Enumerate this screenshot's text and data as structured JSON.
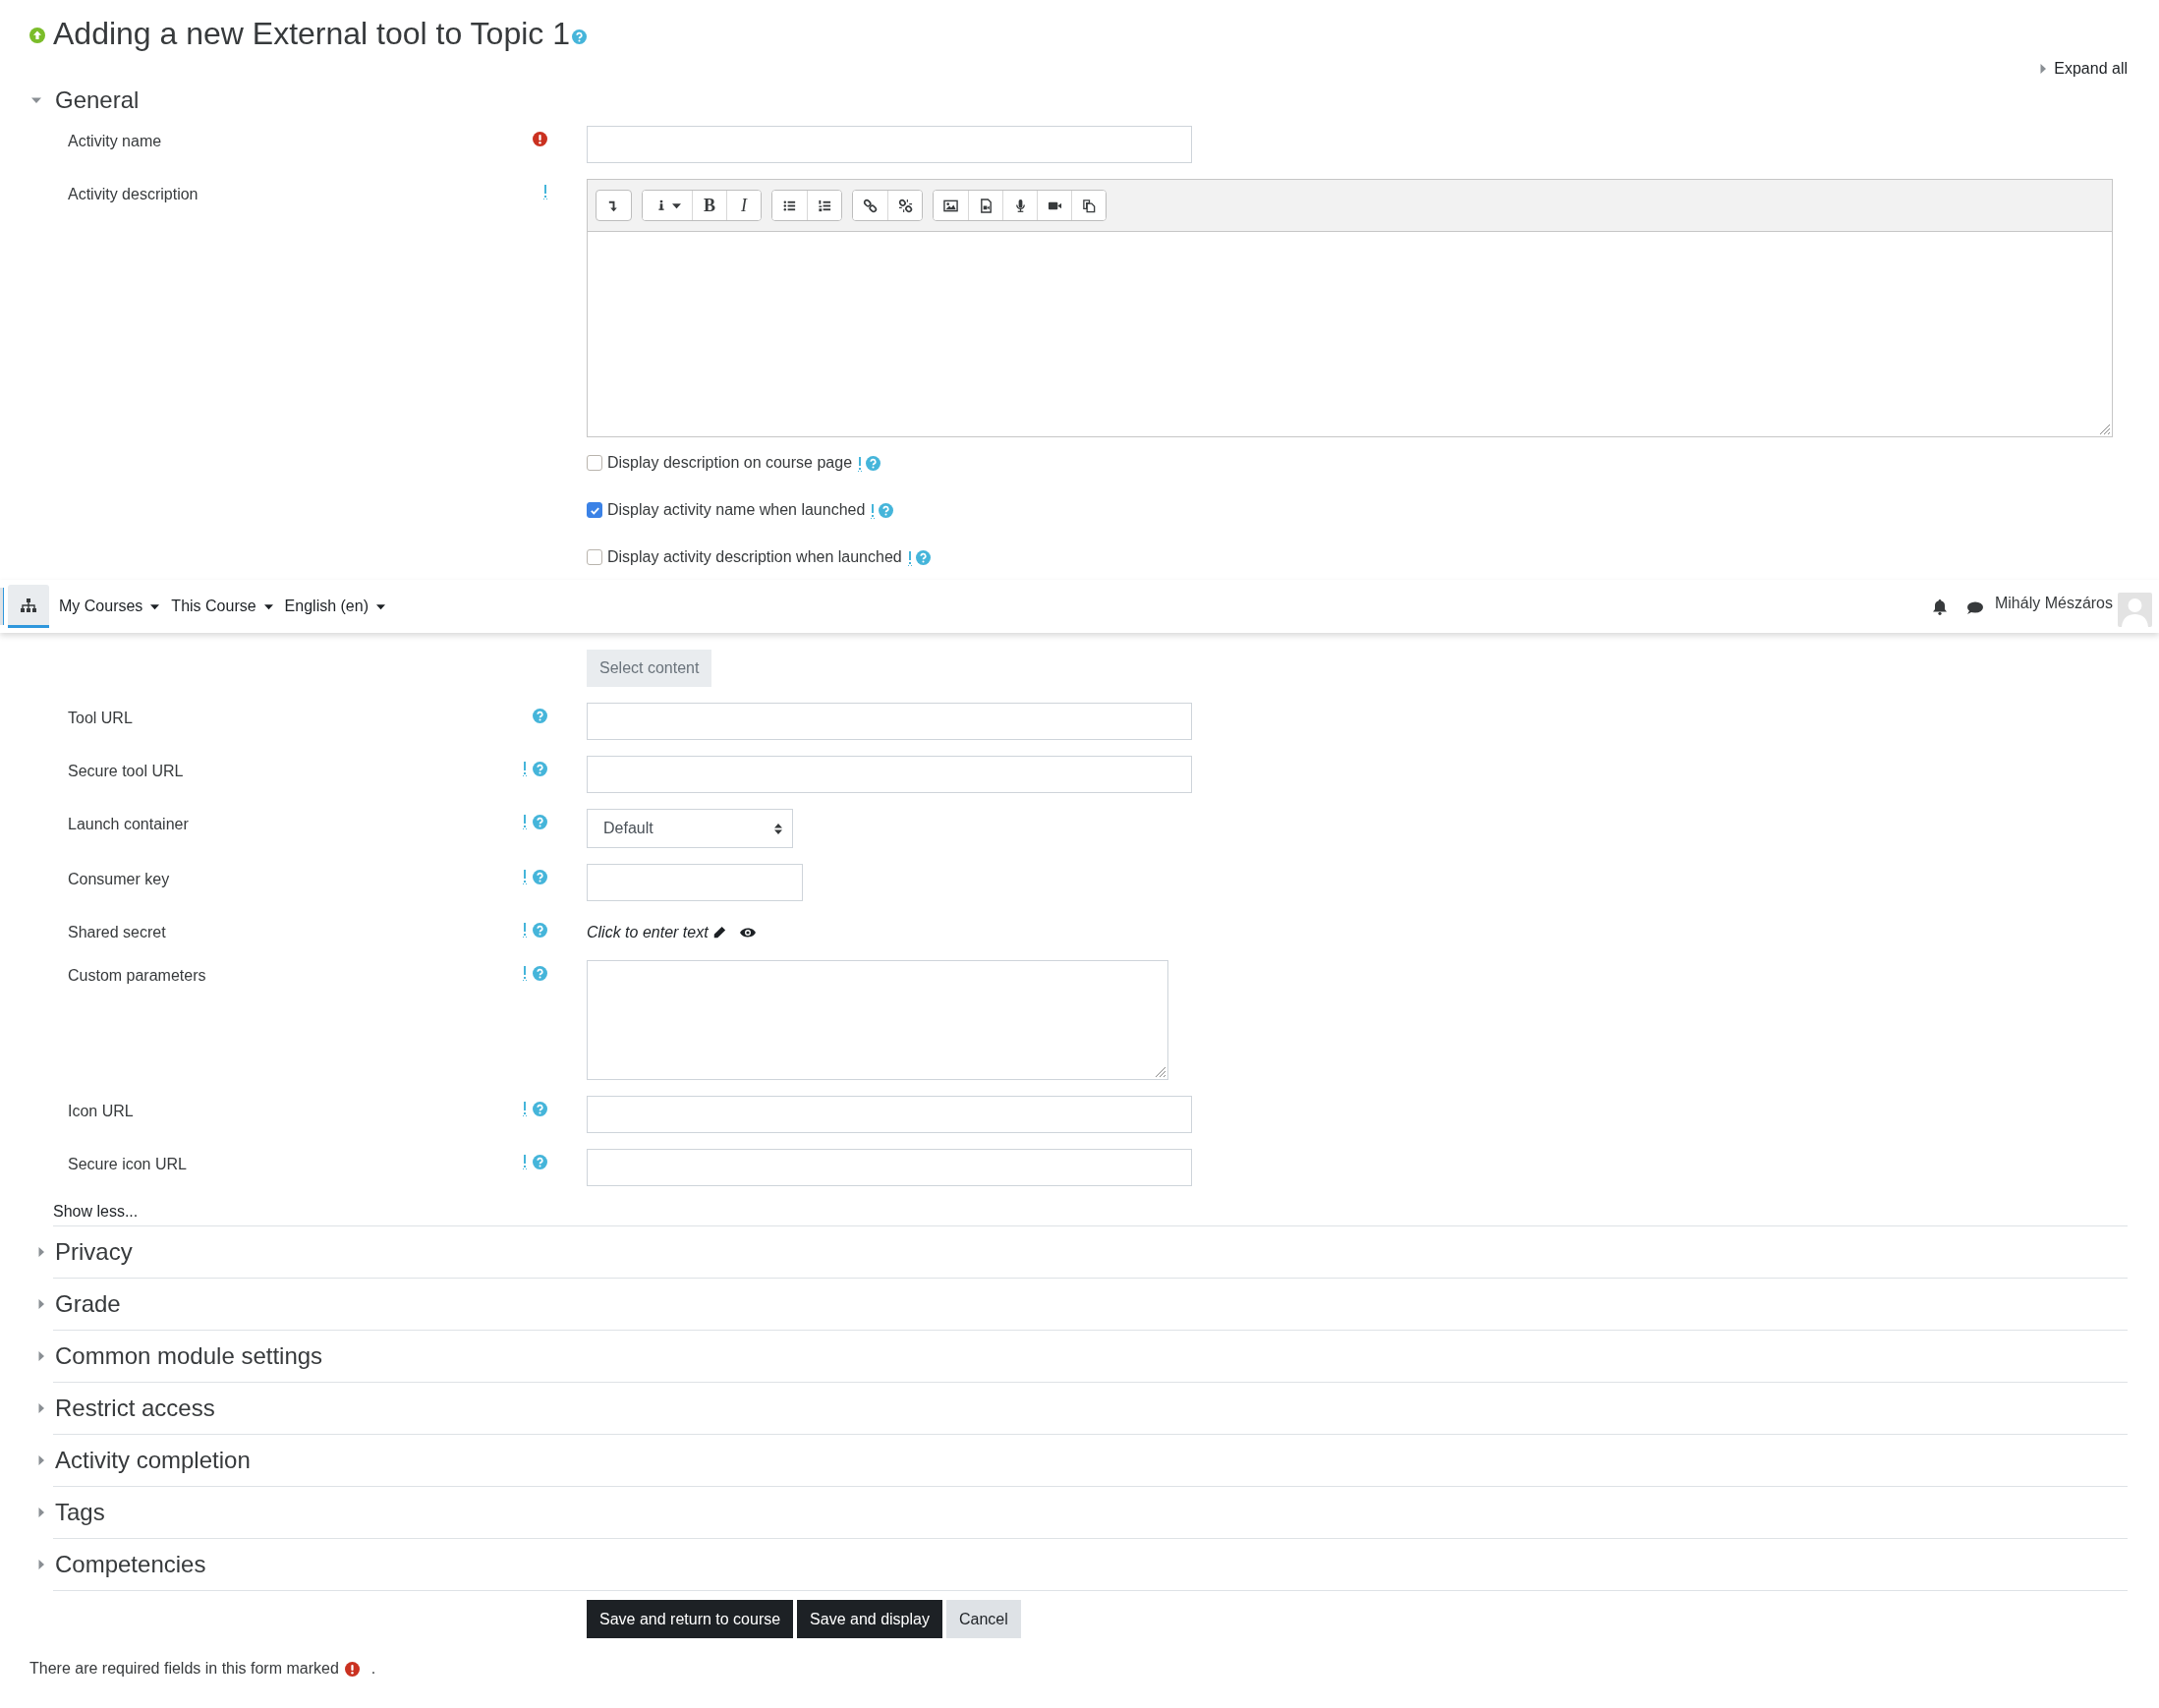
{
  "page_title": "Adding a new External tool to Topic 1",
  "expand_all": "Expand all",
  "general": {
    "title": "General",
    "expanded": true,
    "fields": [
      {
        "kind": "text",
        "label": "Activity name",
        "required": true,
        "advanced": false,
        "help": false
      },
      {
        "kind": "editor",
        "label": "Activity description",
        "required": false,
        "advanced": true,
        "help": false,
        "toolbar": [
          [
            {
              "kind": "collapse"
            }
          ],
          [
            {
              "kind": "style"
            },
            {
              "kind": "bold",
              "label": "B"
            },
            {
              "kind": "italic",
              "label": "I"
            }
          ],
          [
            {
              "kind": "bullets"
            },
            {
              "kind": "numbering"
            }
          ],
          [
            {
              "kind": "link"
            },
            {
              "kind": "unlink"
            }
          ],
          [
            {
              "kind": "image"
            },
            {
              "kind": "media"
            },
            {
              "kind": "audio"
            },
            {
              "kind": "video"
            },
            {
              "kind": "copy"
            }
          ]
        ]
      },
      {
        "kind": "checkbox",
        "label": "Display description on course page",
        "checked": false,
        "advanced": true,
        "help": true
      },
      {
        "kind": "checkbox",
        "label": "Display activity name when launched",
        "checked": true,
        "advanced": true,
        "help": true
      },
      {
        "kind": "checkbox",
        "label": "Display activity description when launched",
        "checked": false,
        "advanced": true,
        "help": true
      },
      {
        "kind": "gap"
      },
      {
        "kind": "button",
        "label": "Select content"
      },
      {
        "kind": "text",
        "label": "Tool URL",
        "required": false,
        "advanced": false,
        "help": true
      },
      {
        "kind": "text",
        "label": "Secure tool URL",
        "required": false,
        "advanced": true,
        "help": true
      },
      {
        "kind": "select",
        "label": "Launch container",
        "required": false,
        "advanced": true,
        "help": true,
        "value": "Default"
      },
      {
        "kind": "short_text",
        "label": "Consumer key",
        "required": false,
        "advanced": true,
        "help": true
      },
      {
        "kind": "secret",
        "label": "Shared secret",
        "required": false,
        "advanced": true,
        "help": true,
        "value": "Click to enter text"
      },
      {
        "kind": "textarea",
        "label": "Custom parameters",
        "required": false,
        "advanced": true,
        "help": true
      },
      {
        "kind": "text",
        "label": "Icon URL",
        "required": false,
        "advanced": true,
        "help": true
      },
      {
        "kind": "text",
        "label": "Secure icon URL",
        "required": false,
        "advanced": true,
        "help": true
      }
    ],
    "show_less": "Show less..."
  },
  "sections": [
    {
      "title": "Privacy",
      "expanded": false
    },
    {
      "title": "Grade",
      "expanded": false
    },
    {
      "title": "Common module settings",
      "expanded": false
    },
    {
      "title": "Restrict access",
      "expanded": false
    },
    {
      "title": "Activity completion",
      "expanded": false
    },
    {
      "title": "Tags",
      "expanded": false
    },
    {
      "title": "Competencies",
      "expanded": false
    }
  ],
  "buttons": [
    {
      "label": "Save and return to course",
      "kind": "primary"
    },
    {
      "label": "Save and display",
      "kind": "primary"
    },
    {
      "label": "Cancel",
      "kind": "secondary"
    }
  ],
  "required_note": "There are required fields in this form marked",
  "required_note_end": ".",
  "navbar": {
    "menus": [
      "My Courses",
      "This Course",
      "English (en)"
    ],
    "user": "Mihály Mészáros"
  }
}
